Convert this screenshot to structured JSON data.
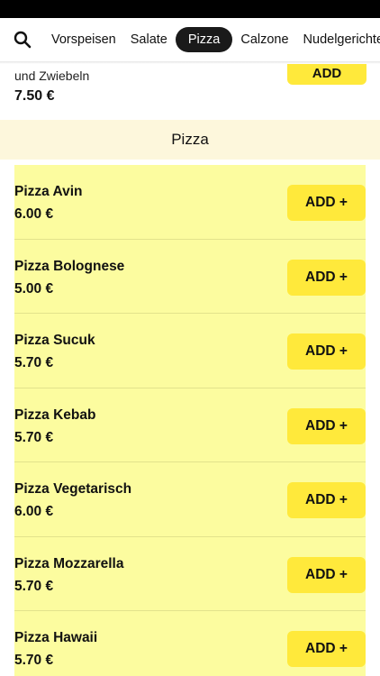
{
  "nav": {
    "search_icon": "search-icon",
    "tabs": [
      {
        "label": "Vorspeisen",
        "active": false
      },
      {
        "label": "Salate",
        "active": false
      },
      {
        "label": "Pizza",
        "active": true
      },
      {
        "label": "Calzone",
        "active": false
      },
      {
        "label": "Nudelgerichte",
        "active": false
      }
    ]
  },
  "prev_item": {
    "desc": "und Zwiebeln",
    "price": "7.50 €",
    "add_label": "ADD"
  },
  "section": {
    "title": "Pizza"
  },
  "items": [
    {
      "name": "Pizza Avin",
      "price": "6.00 €",
      "add_label": "ADD +"
    },
    {
      "name": "Pizza Bolognese",
      "price": "5.00 €",
      "add_label": "ADD +"
    },
    {
      "name": "Pizza Sucuk",
      "price": "5.70 €",
      "add_label": "ADD +"
    },
    {
      "name": "Pizza Kebab",
      "price": "5.70 €",
      "add_label": "ADD +"
    },
    {
      "name": "Pizza Vegetarisch",
      "price": "6.00 €",
      "add_label": "ADD +"
    },
    {
      "name": "Pizza Mozzarella",
      "price": "5.70 €",
      "add_label": "ADD +"
    },
    {
      "name": "Pizza Hawaii",
      "price": "5.70 €",
      "add_label": "ADD +"
    }
  ],
  "colors": {
    "accent": "#ffe93b",
    "item_bg": "#fcfc9f",
    "section_bg": "#fdf7dc",
    "active_tab": "#1a1a1a"
  }
}
